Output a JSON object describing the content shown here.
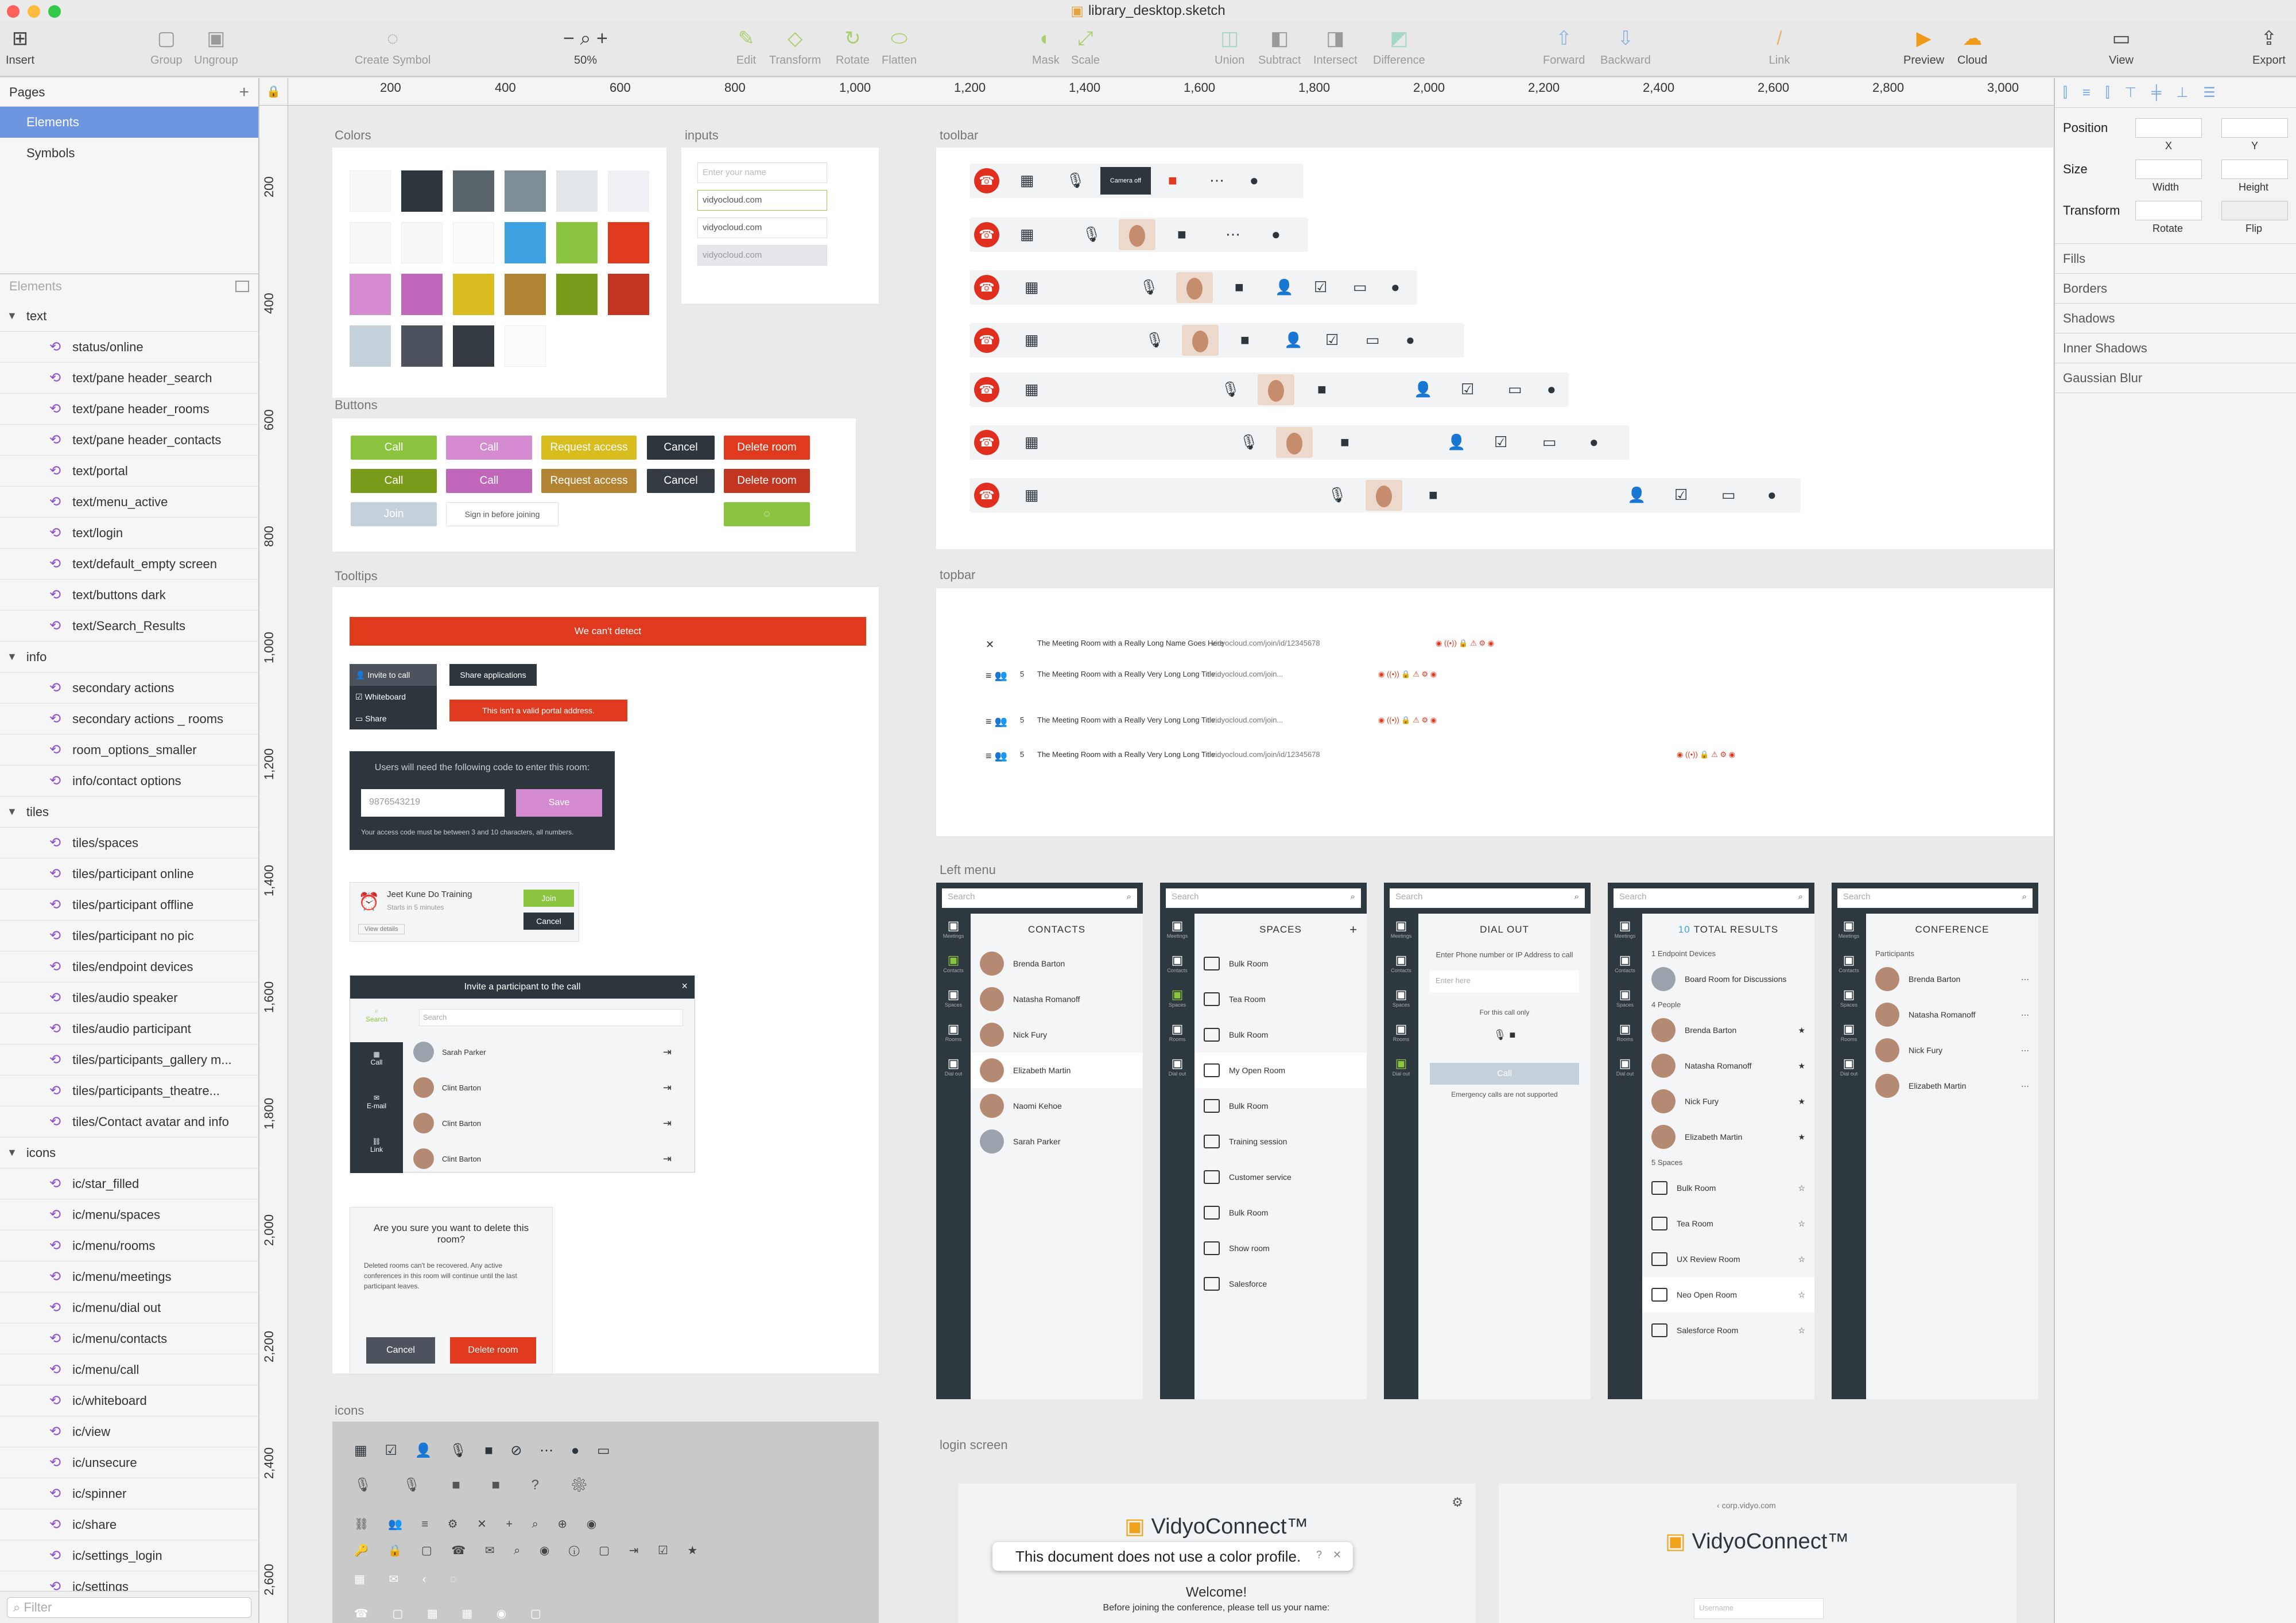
{
  "window": {
    "title": "library_desktop.sketch"
  },
  "toolbar": {
    "insert": "Insert",
    "group": "Group",
    "ungroup": "Ungroup",
    "create_symbol": "Create Symbol",
    "zoom_minus": "−",
    "zoom_plus": "+",
    "zoom": "50%",
    "edit": "Edit",
    "transform": "Transform",
    "rotate": "Rotate",
    "flatten": "Flatten",
    "mask": "Mask",
    "scale": "Scale",
    "union": "Union",
    "subtract": "Subtract",
    "intersect": "Intersect",
    "difference": "Difference",
    "forward": "Forward",
    "backward": "Backward",
    "link": "Link",
    "preview": "Preview",
    "cloud": "Cloud",
    "view": "View",
    "export": "Export"
  },
  "pages": {
    "header": "Pages",
    "items": [
      "Elements",
      "Symbols"
    ]
  },
  "layers": {
    "header": "Elements",
    "groups": [
      {
        "name": "text",
        "items": [
          "status/online",
          "text/pane header_search",
          "text/pane header_rooms",
          "text/pane header_contacts",
          "text/portal",
          "text/menu_active",
          "text/login",
          "text/default_empty screen",
          "text/buttons dark",
          "text/Search_Results"
        ]
      },
      {
        "name": "info",
        "items": [
          "secondary actions",
          "secondary actions _ rooms",
          "room_options_smaller",
          "info/contact options"
        ]
      },
      {
        "name": "tiles",
        "items": [
          "tiles/spaces",
          "tiles/participant online",
          "tiles/participant offline",
          "tiles/participant no pic",
          "tiles/endpoint devices",
          "tiles/audio speaker",
          "tiles/audio participant",
          "tiles/participants_gallery m...",
          "tiles/participants_theatre...",
          "tiles/Contact avatar and info"
        ]
      },
      {
        "name": "icons",
        "items": [
          "ic/star_filled",
          "ic/menu/spaces",
          "ic/menu/rooms",
          "ic/menu/meetings",
          "ic/menu/dial out",
          "ic/menu/contacts",
          "ic/menu/call",
          "ic/whiteboard",
          "ic/view",
          "ic/unsecure",
          "ic/spinner",
          "ic/share",
          "ic/settings_login",
          "ic/settings"
        ]
      }
    ],
    "filter_placeholder": "Filter"
  },
  "rulers": {
    "top": [
      "200",
      "400",
      "600",
      "800",
      "1,000",
      "1,200",
      "1,400",
      "1,600",
      "1,800",
      "2,000",
      "2,200",
      "2,400",
      "2,600",
      "2,800",
      "3,000"
    ],
    "left": [
      "200",
      "400",
      "600",
      "800",
      "1,000",
      "1,200",
      "1,400",
      "1,600",
      "1,800",
      "2,000",
      "2,200",
      "2,400",
      "2,600"
    ]
  },
  "artboards": {
    "colors": "Colors",
    "inputs": "inputs",
    "buttons": "Buttons",
    "tooltips": "Tooltips",
    "icons": "icons",
    "toolbar": "toolbar",
    "topbar": "topbar",
    "left_menu": "Left menu",
    "login": "login screen"
  },
  "swatches": [
    "#f7f8fa",
    "#2d363d",
    "#5a646b",
    "#7f8e96",
    "#e4e7ea",
    "#eef0f3",
    "#f5f6f8",
    "#f7f8fa",
    "#f9fafb",
    "#3fa2e0",
    "#8bc53f",
    "#e03a1e",
    "#d58bd0",
    "#c067b9",
    "#d9bc1e",
    "#b28332",
    "#7a9b1a",
    "#c23520",
    "#c4d1da",
    "#4d535c",
    "#353b42",
    "#fbfbfc"
  ],
  "inputs": {
    "placeholder": "Enter your name",
    "values": [
      "vidyocloud.com",
      "vidyocloud.com",
      "vidyocloud.com"
    ]
  },
  "buttons": {
    "call": "Call",
    "request": "Request access",
    "cancel": "Cancel",
    "delete": "Delete room",
    "join": "Join",
    "sign_in": "Sign in before joining"
  },
  "tooltips": {
    "error_bar": "We can't detect",
    "menu": [
      "Invite to call",
      "Whiteboard",
      "Share"
    ],
    "share_apps": "Share applications",
    "invalid": "This isn't a valid portal address.",
    "code_title": "Users will need the following code to enter this room:",
    "code_value": "9876543219",
    "code_save": "Save",
    "code_hint": "Your access code must be between 3 and 10 characters, all numbers.",
    "meeting_title": "Jeet Kune Do Training",
    "meeting_sub": "Starts in 5 minutes",
    "meeting_details": "View details",
    "meeting_join": "Join",
    "meeting_cancel": "Cancel",
    "invite_title": "Invite a participant to the call",
    "invite_search": "Search",
    "invite_tabs": [
      "Search",
      "Call",
      "E-mail",
      "Link"
    ],
    "invite_people": [
      "Sarah Parker",
      "Clint Barton",
      "Clint Barton",
      "Clint Barton"
    ],
    "delete_title": "Are you sure you want to delete this room?",
    "delete_body": "Deleted rooms can't be recovered. Any active conferences in this room will continue until the last participant leaves.",
    "delete_cancel": "Cancel",
    "delete_confirm": "Delete room"
  },
  "toolbar_art": {
    "camera_off": "Camera off"
  },
  "topbar": {
    "rows": [
      {
        "count": "",
        "name": "The Meeting Room with a Really Long Name Goes Here",
        "link": "vidyocloud.com/join/id/12345678"
      },
      {
        "count": "5",
        "name": "The Meeting Room with a Really Very Long Long Title...",
        "link": "vidyocloud.com/join..."
      },
      {
        "count": "5",
        "name": "The Meeting Room with a Really Very Long Long Title...",
        "link": "vidyocloud.com/join..."
      },
      {
        "count": "5",
        "name": "The Meeting Room with a Really Very Long Long Title...",
        "link": "vidyocloud.com/join/id/12345678"
      }
    ]
  },
  "left_menu": {
    "search": "Search",
    "rail": [
      "Meetings",
      "Contacts",
      "Spaces",
      "Rooms",
      "Dial out"
    ],
    "contacts": {
      "title": "CONTACTS",
      "people": [
        "Brenda Barton",
        "Natasha Romanoff",
        "Nick Fury",
        "Elizabeth Martin",
        "Naomi Kehoe",
        "Sarah Parker"
      ]
    },
    "spaces": {
      "title": "SPACES",
      "rooms": [
        "Bulk Room",
        "Tea Room",
        "Bulk Room",
        "My Open Room",
        "Bulk Room",
        "Training session",
        "Customer service",
        "Bulk Room",
        "Show room",
        "Salesforce"
      ]
    },
    "dial": {
      "title": "DIAL OUT",
      "prompt": "Enter Phone number or IP Address to call",
      "placeholder": "Enter here",
      "note": "For this call only",
      "call": "Call",
      "emergency": "Emergency calls are not supported"
    },
    "results": {
      "count": "10",
      "title": "TOTAL RESULTS",
      "endpoint_head": "1 Endpoint Devices",
      "endpoint": "Board Room for Discussions",
      "people_head": "4 People",
      "people": [
        "Brenda Barton",
        "Natasha Romanoff",
        "Nick Fury",
        "Elizabeth Martin"
      ],
      "spaces_head": "5 Spaces",
      "spaces": [
        "Bulk Room",
        "Tea Room",
        "UX Review Room",
        "Neo Open Room",
        "Salesforce Room"
      ]
    },
    "conference": {
      "title": "CONFERENCE",
      "participants_head": "Participants",
      "people": [
        "Brenda Barton",
        "Natasha Romanoff",
        "Nick Fury",
        "Elizabeth Martin"
      ]
    }
  },
  "login": {
    "brand": "VidyoConnect™",
    "notice": "This document does not use a color profile.",
    "welcome": "Welcome!",
    "before": "Before joining the conference, please tell us your name:",
    "portal": "corp.vidyo.com",
    "username": "Username"
  },
  "properties": {
    "position": "Position",
    "x": "X",
    "y": "Y",
    "size": "Size",
    "width": "Width",
    "height": "Height",
    "transform": "Transform",
    "rotate": "Rotate",
    "flip": "Flip",
    "sections": [
      "Fills",
      "Borders",
      "Shadows",
      "Inner Shadows",
      "Gaussian Blur"
    ]
  }
}
